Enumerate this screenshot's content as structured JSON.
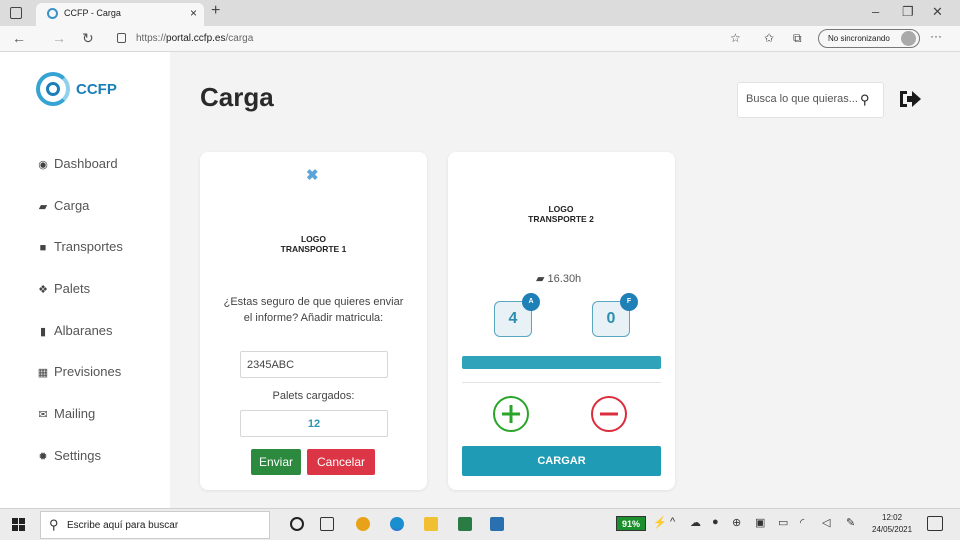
{
  "browser": {
    "tab_title": "CCFP - Carga",
    "tab_close": "×",
    "new_tab": "+",
    "url_scheme": "https://",
    "url_host": "portal.ccfp.es",
    "url_path": "/carga",
    "sync_label": "No sincronizando",
    "more": "···",
    "window_controls": [
      "–",
      "❐",
      "✕"
    ]
  },
  "app": {
    "logo_text": "CCFP",
    "sidebar": [
      {
        "label": "Dashboard",
        "icon": "dashboard-icon",
        "glyph": "◉"
      },
      {
        "label": "Carga",
        "icon": "truck-icon",
        "glyph": "▰"
      },
      {
        "label": "Transportes",
        "icon": "box-icon",
        "glyph": "■"
      },
      {
        "label": "Palets",
        "icon": "cubes-icon",
        "glyph": "❖"
      },
      {
        "label": "Albaranes",
        "icon": "file-icon",
        "glyph": "▮"
      },
      {
        "label": "Previsiones",
        "icon": "calculator-icon",
        "glyph": "▦"
      },
      {
        "label": "Mailing",
        "icon": "envelope-icon",
        "glyph": "✉"
      },
      {
        "label": "Settings",
        "icon": "gear-icon",
        "glyph": "✹"
      }
    ],
    "page_title": "Carga",
    "search_placeholder": "Busca lo que quieras..."
  },
  "card1": {
    "close": "✖",
    "logo_line1": "LOGO",
    "logo_line2": "TRANSPORTE 1",
    "prompt": "¿Estas seguro de que quieres enviar el informe? Añadir matricula:",
    "plate_value": "2345ABC",
    "pallets_label": "Palets cargados:",
    "pallets_value": "12",
    "send": "Enviar",
    "cancel": "Cancelar"
  },
  "card2": {
    "logo_line1": "LOGO",
    "logo_line2": "TRANSPORTE 2",
    "time": "16.30h",
    "counter_a_badge": "A",
    "counter_a_value": "4",
    "counter_f_badge": "F",
    "counter_f_value": "0",
    "progress": 1.0,
    "load_button": "CARGAR"
  },
  "taskbar": {
    "search_text": "Escribe aquí para buscar",
    "battery": "91%",
    "time": "12:02",
    "date": "24/05/2021"
  },
  "colors": {
    "accent": "#1f9bb5",
    "send": "#2b8a3e",
    "cancel": "#dc3545",
    "plus": "#2aa52a",
    "minus": "#dc2d3c"
  }
}
